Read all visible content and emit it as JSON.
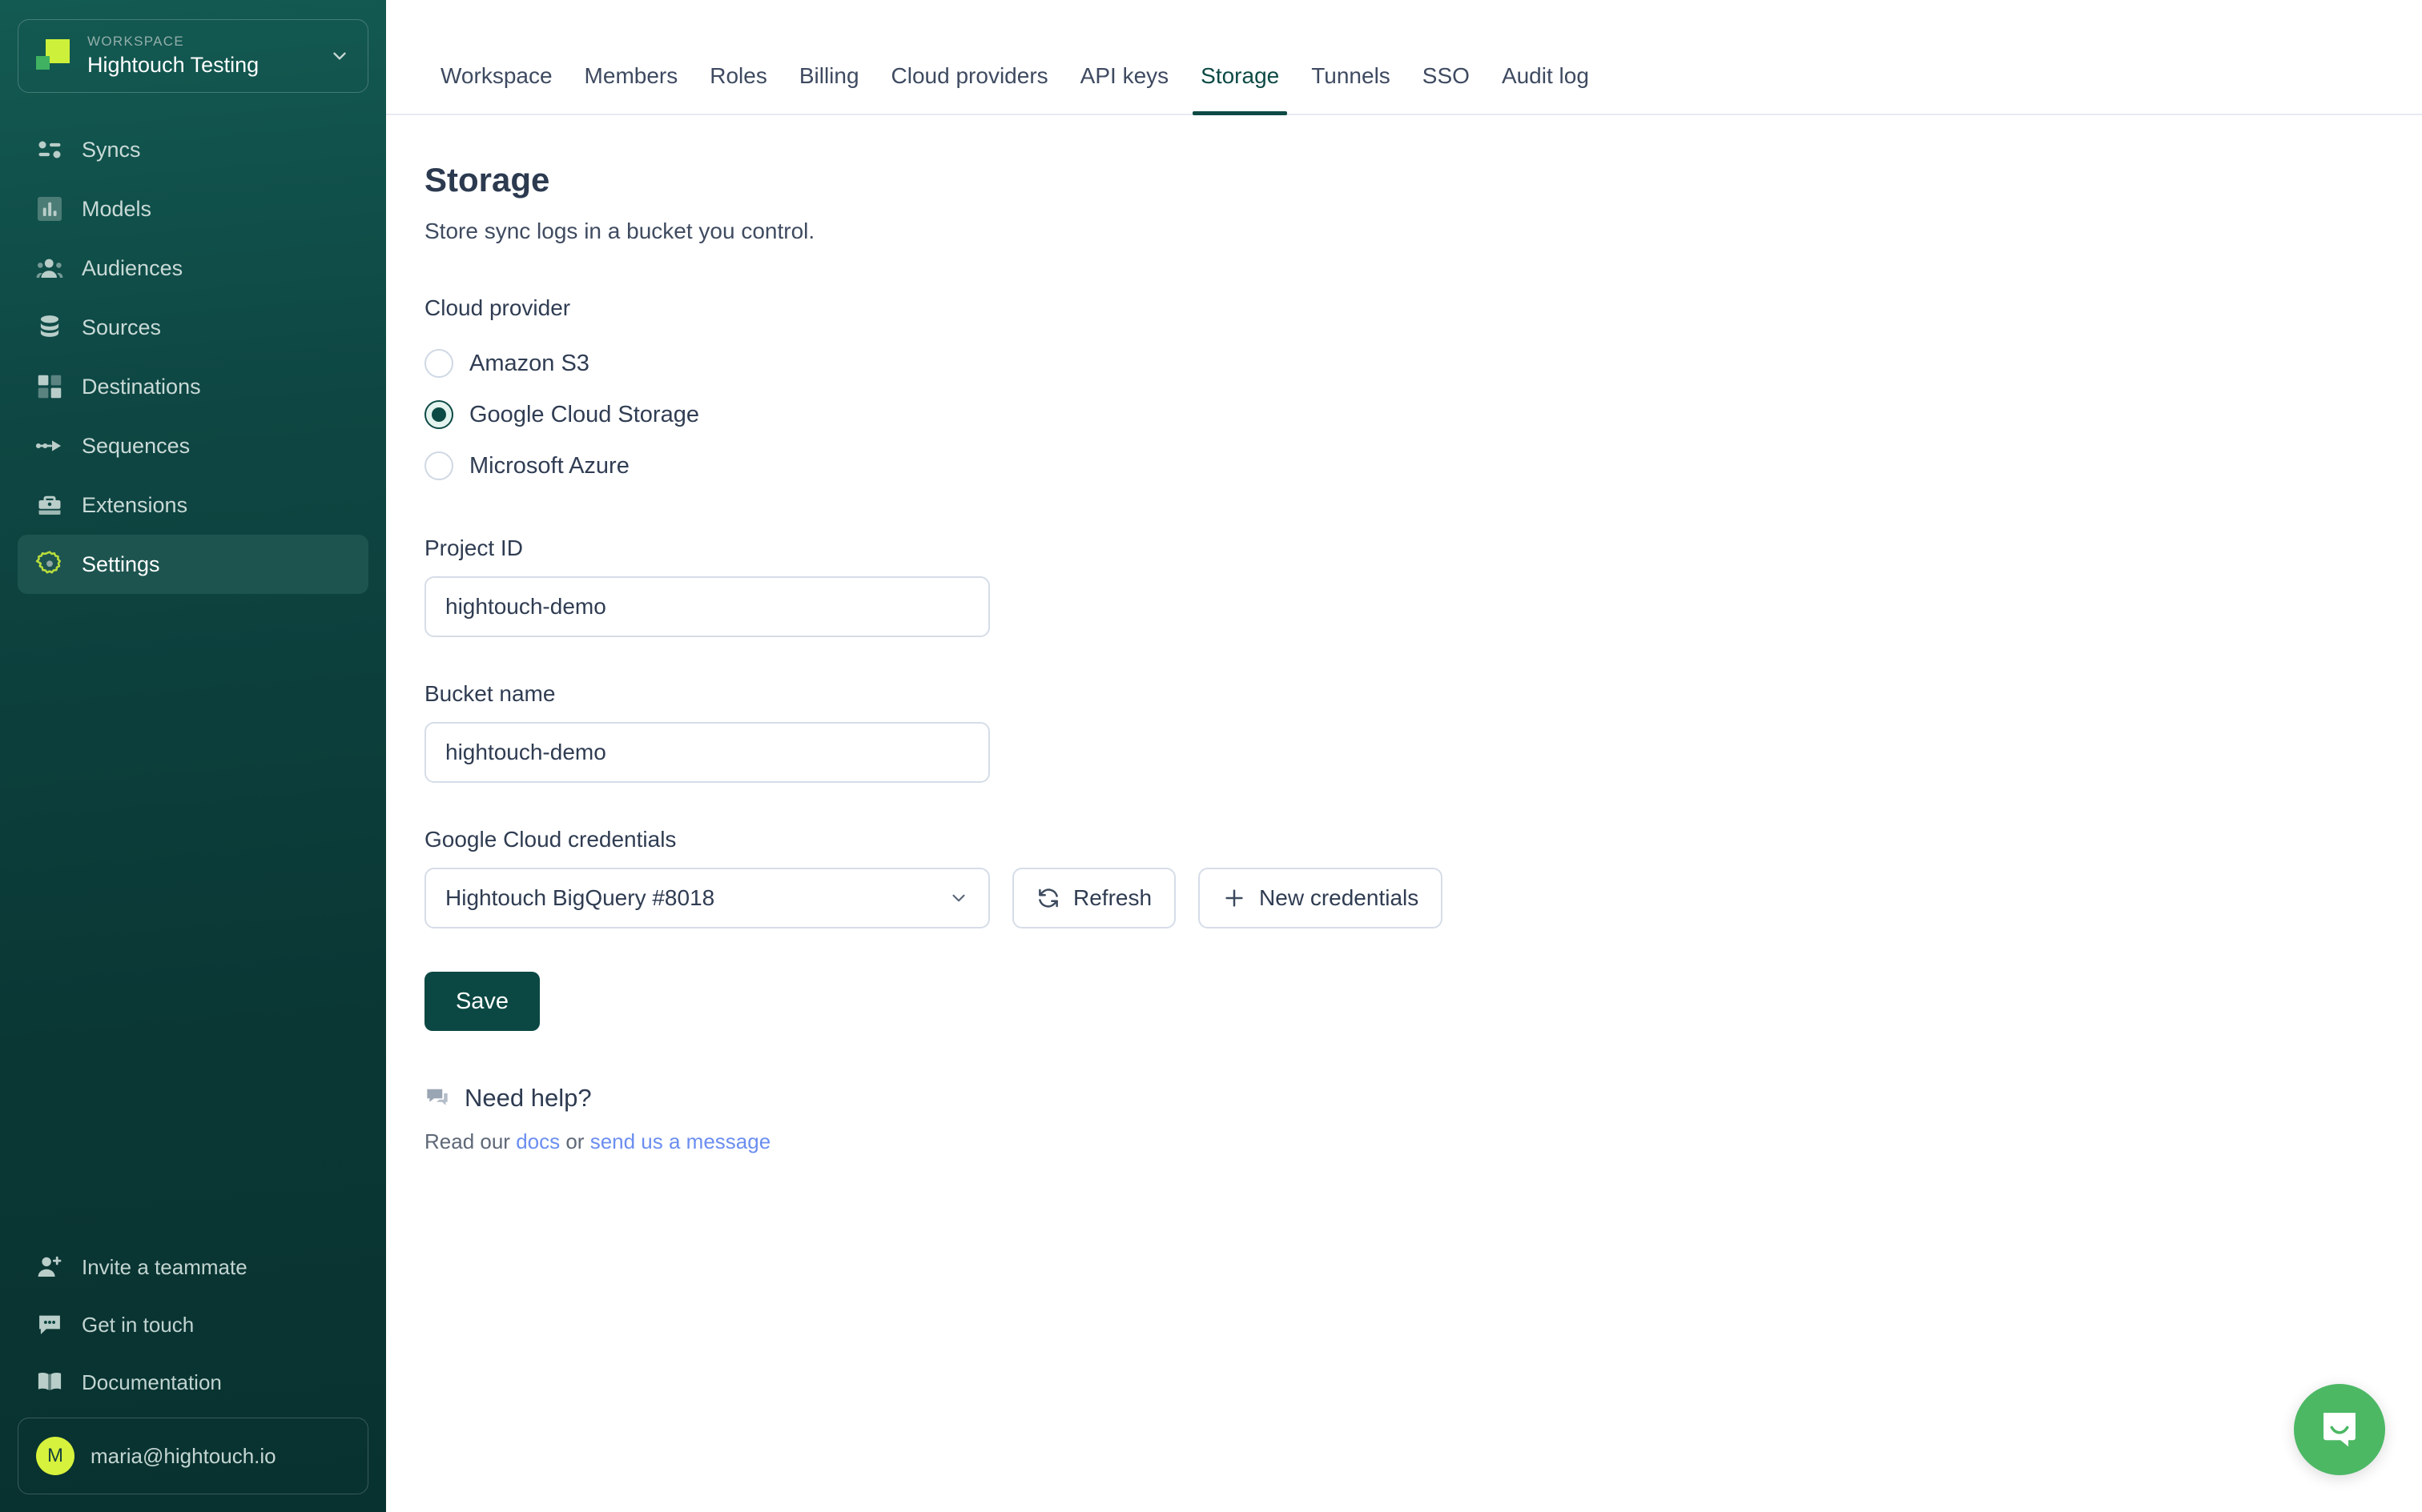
{
  "sidebar": {
    "workspace": {
      "label": "WORKSPACE",
      "name": "Hightouch Testing",
      "chevron_icon": "chevron-down-icon",
      "logo_icon": "hightouch-logo-icon"
    },
    "items": [
      {
        "label": "Syncs",
        "icon": "syncs-icon"
      },
      {
        "label": "Models",
        "icon": "models-bar-chart-icon"
      },
      {
        "label": "Audiences",
        "icon": "audiences-people-icon"
      },
      {
        "label": "Sources",
        "icon": "sources-database-icon"
      },
      {
        "label": "Destinations",
        "icon": "destinations-grid-icon"
      },
      {
        "label": "Sequences",
        "icon": "sequences-arrow-icon"
      },
      {
        "label": "Extensions",
        "icon": "extensions-briefcase-icon"
      },
      {
        "label": "Settings",
        "icon": "settings-gear-icon"
      }
    ],
    "active_item": "Settings",
    "bottom_items": [
      {
        "label": "Invite a teammate",
        "icon": "user-plus-icon"
      },
      {
        "label": "Get in touch",
        "icon": "chat-bubble-icon"
      },
      {
        "label": "Documentation",
        "icon": "book-icon"
      }
    ],
    "user": {
      "avatar_initial": "M",
      "email": "maria@hightouch.io"
    }
  },
  "tabs": [
    {
      "label": "Workspace",
      "active": false
    },
    {
      "label": "Members",
      "active": false
    },
    {
      "label": "Roles",
      "active": false
    },
    {
      "label": "Billing",
      "active": false
    },
    {
      "label": "Cloud providers",
      "active": false
    },
    {
      "label": "API keys",
      "active": false
    },
    {
      "label": "Storage",
      "active": true
    },
    {
      "label": "Tunnels",
      "active": false
    },
    {
      "label": "SSO",
      "active": false
    },
    {
      "label": "Audit log",
      "active": false
    }
  ],
  "page": {
    "title": "Storage",
    "subtitle": "Store sync logs in a bucket you control."
  },
  "cloud_provider": {
    "label": "Cloud provider",
    "options": [
      {
        "label": "Amazon S3",
        "selected": false
      },
      {
        "label": "Google Cloud Storage",
        "selected": true
      },
      {
        "label": "Microsoft Azure",
        "selected": false
      }
    ]
  },
  "project_id": {
    "label": "Project ID",
    "value": "hightouch-demo",
    "placeholder": "hightouch-demo"
  },
  "bucket_name": {
    "label": "Bucket name",
    "value": "hightouch-demo",
    "placeholder": "hightouch-demo"
  },
  "credentials": {
    "label": "Google Cloud credentials",
    "selected": "Hightouch BigQuery #8018",
    "chevron_icon": "chevron-down-icon",
    "refresh_label": "Refresh",
    "refresh_icon": "refresh-icon",
    "new_label": "New credentials",
    "new_icon": "plus-icon"
  },
  "save_label": "Save",
  "help": {
    "icon": "chat-help-icon",
    "title": "Need help?",
    "prefix": "Read our ",
    "docs_link": "docs",
    "middle": " or ",
    "message_link": "send us a message"
  },
  "intercom": {
    "icon": "intercom-chat-icon"
  },
  "colors": {
    "sidebar_bg": "#0d4643",
    "sidebar_active": "#1d5450",
    "accent_lime": "#cdf03a",
    "accent_green": "#3fb161",
    "primary_teal": "#0b4843",
    "link_blue": "#6b8ef0",
    "intercom_green": "#4cb864",
    "border_grey": "#d6dde8"
  }
}
